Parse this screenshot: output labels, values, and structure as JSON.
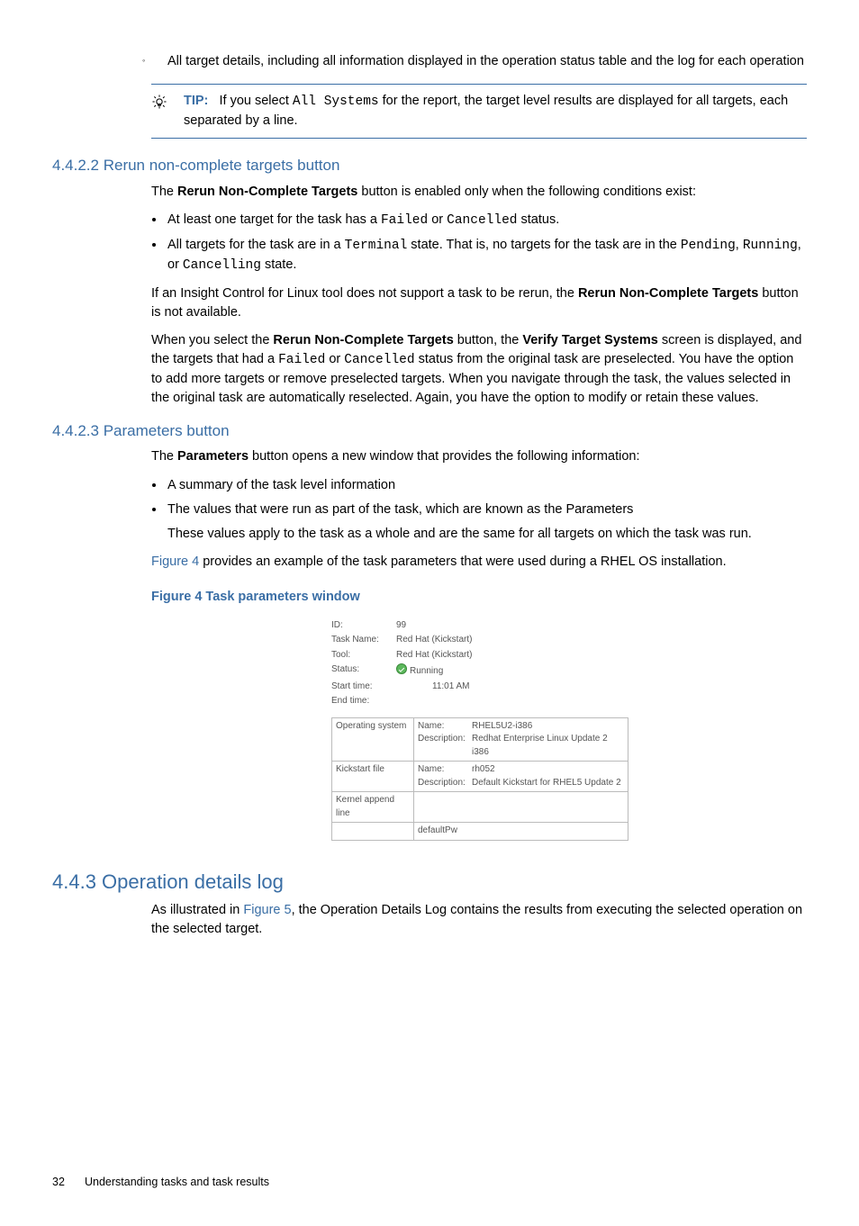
{
  "top_bullet": "All target details, including all information displayed in the operation status table and the log for each operation",
  "tip": {
    "label": "TIP:",
    "pre": "If you select ",
    "code": "All Systems",
    "post": " for the report, the target level results are displayed for all targets, each separated by a line."
  },
  "sec4422": {
    "heading": "4.4.2.2 Rerun non-complete targets button",
    "p1_a": "The ",
    "p1_b": "Rerun Non-Complete Targets",
    "p1_c": " button is enabled only when the following conditions exist:",
    "b1_a": "At least one target for the task has a ",
    "b1_code1": "Failed",
    "b1_mid": " or ",
    "b1_code2": "Cancelled",
    "b1_end": " status.",
    "b2_a": "All targets for the task are in a ",
    "b2_code1": "Terminal",
    "b2_b": " state. That is, no targets for the task are in the ",
    "b2_code2": "Pending",
    "b2_c": ", ",
    "b2_code3": "Running",
    "b2_d": ", or ",
    "b2_code4": "Cancelling",
    "b2_e": " state.",
    "p2_a": "If an Insight Control for Linux tool does not support a task to be rerun, the ",
    "p2_b": "Rerun Non-Complete Targets",
    "p2_c": " button is not available.",
    "p3_a": "When you select the ",
    "p3_b": "Rerun Non-Complete Targets",
    "p3_c": " button, the ",
    "p3_d": "Verify Target Systems",
    "p3_e": " screen is displayed, and the targets that had a ",
    "p3_code1": "Failed",
    "p3_f": " or ",
    "p3_code2": "Cancelled",
    "p3_g": " status from the original task are preselected. You have the option to add more targets or remove preselected targets. When you navigate through the task, the values selected in the original task are automatically reselected. Again, you have the option to modify or retain these values."
  },
  "sec4423": {
    "heading": "4.4.2.3 Parameters button",
    "p1_a": "The ",
    "p1_b": "Parameters",
    "p1_c": " button opens a new window that provides the following information:",
    "b1": "A summary of the task level information",
    "b2": "The values that were run as part of the task, which are known as the Parameters",
    "b2sub": "These values apply to the task as a whole and are the same for all targets on which the task was run.",
    "p2_a": "Figure 4",
    "p2_b": " provides an example of the task parameters that were used during a RHEL OS installation.",
    "figcap": "Figure 4 Task parameters window"
  },
  "fig": {
    "id_l": "ID:",
    "id_v": "99",
    "tn_l": "Task Name:",
    "tn_v": "Red Hat (Kickstart)",
    "tl_l": "Tool:",
    "tl_v": "Red Hat (Kickstart)",
    "st_l": "Status:",
    "st_v": "Running",
    "start_l": "Start time:",
    "start_v": "11:01 AM",
    "end_l": "End time:",
    "end_v": "",
    "row1_h": "Operating system",
    "row1_name_l": "Name:",
    "row1_name_v": "RHEL5U2-i386",
    "row1_desc_l": "Description:",
    "row1_desc_v": "Redhat Enterprise Linux Update 2 i386",
    "row2_h": "Kickstart file",
    "row2_name_l": "Name:",
    "row2_name_v": "rh052",
    "row2_desc_l": "Description:",
    "row2_desc_v": "Default Kickstart for RHEL5 Update 2",
    "row3_h": "Kernel append line",
    "row4_v": "defaultPw"
  },
  "sec443": {
    "heading": "4.4.3 Operation details log",
    "p_a": "As illustrated in ",
    "p_link": "Figure 5",
    "p_b": ", the Operation Details Log contains the results from executing the selected operation on the selected target."
  },
  "footer": {
    "page": "32",
    "title": "Understanding tasks and task results"
  }
}
